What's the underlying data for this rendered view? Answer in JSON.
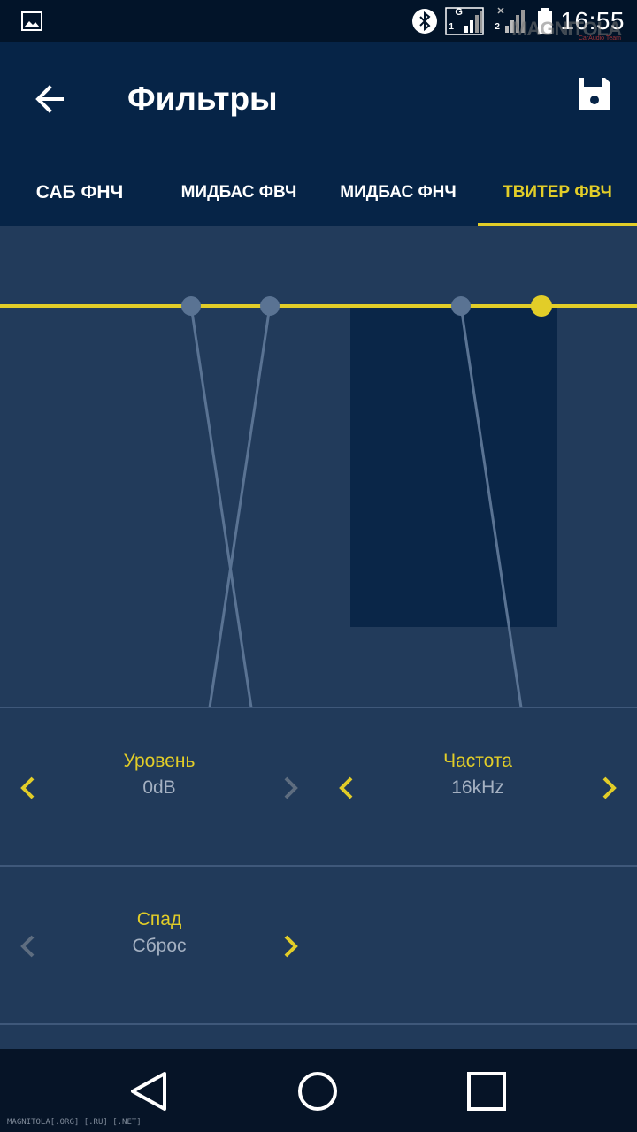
{
  "status_bar": {
    "time": "16:55",
    "network_label": "G",
    "sim1": "1",
    "sim2": "2",
    "watermark": "MAGNITOLA",
    "watermark_sub": "CarAudio Team",
    "icons": [
      "gallery-icon",
      "bluetooth-icon",
      "signal-icon",
      "signal-icon",
      "battery-icon"
    ]
  },
  "header": {
    "title": "Фильтры",
    "back_icon": "arrow-left-icon",
    "save_icon": "floppy-save-icon"
  },
  "tabs": [
    {
      "label": "САБ ФНЧ",
      "active": false
    },
    {
      "label": "МИДБАС ФВЧ",
      "active": false
    },
    {
      "label": "МИДБАС ФНЧ",
      "active": false
    },
    {
      "label": "ТВИТЕР ФВЧ",
      "active": true
    }
  ],
  "controls": {
    "level": {
      "label": "Уровень",
      "value": "0dB"
    },
    "frequency": {
      "label": "Частота",
      "value": "16kHz"
    },
    "slope": {
      "label": "Спад",
      "value": "Сброс"
    }
  },
  "footer": {
    "watermark": "MAGNITOLA[.ORG] [.RU] [.NET]"
  },
  "colors": {
    "accent": "#e2cd28",
    "appbar": "#062447",
    "background": "#223b5b",
    "curve": "#5a7393",
    "highlight": "#0a2648"
  }
}
